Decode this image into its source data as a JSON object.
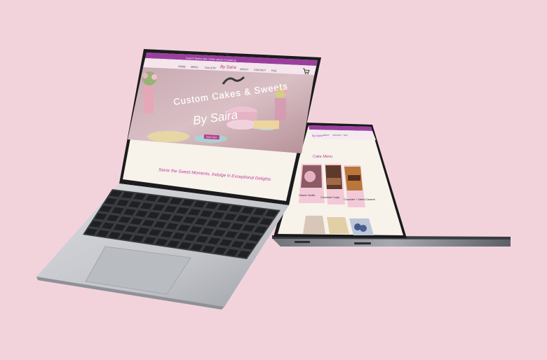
{
  "colors": {
    "background": "#f2d3dc",
    "purple_bar": "#9b3f9f",
    "cream": "#f7f2ea",
    "heading_pink": "#c2399a"
  },
  "front_laptop": {
    "announcement": "Custom Orders Only  |  Order ahead  |  Contact us",
    "nav": {
      "items": [
        "HOME",
        "MENU",
        "GALLERY",
        "ABOUT",
        "CONTACT",
        "FAQ"
      ],
      "logo": "By Saira",
      "cart_icon": "cart-icon"
    },
    "hero": {
      "title": "Custom Cakes & Sweets",
      "signature": "By Saira",
      "button": "Order Now"
    },
    "tagline": "Savor the Sweet Moments, Indulge in Exceptional Delights"
  },
  "back_laptop": {
    "nav": {
      "logo": "By Saira",
      "items": [
        "ABOUT",
        "CONTACT",
        "FAQ"
      ]
    },
    "section_title": "Cake Menu",
    "cards": [
      {
        "name": "Classic Vanilla",
        "desc": "Vanilla sponge with buttercream"
      },
      {
        "name": "Chocolate Fudge",
        "desc": "Rich chocolate layers"
      },
      {
        "name": "Chocolate + Salted Caramel",
        "desc": "Chocolate with caramel"
      }
    ]
  }
}
